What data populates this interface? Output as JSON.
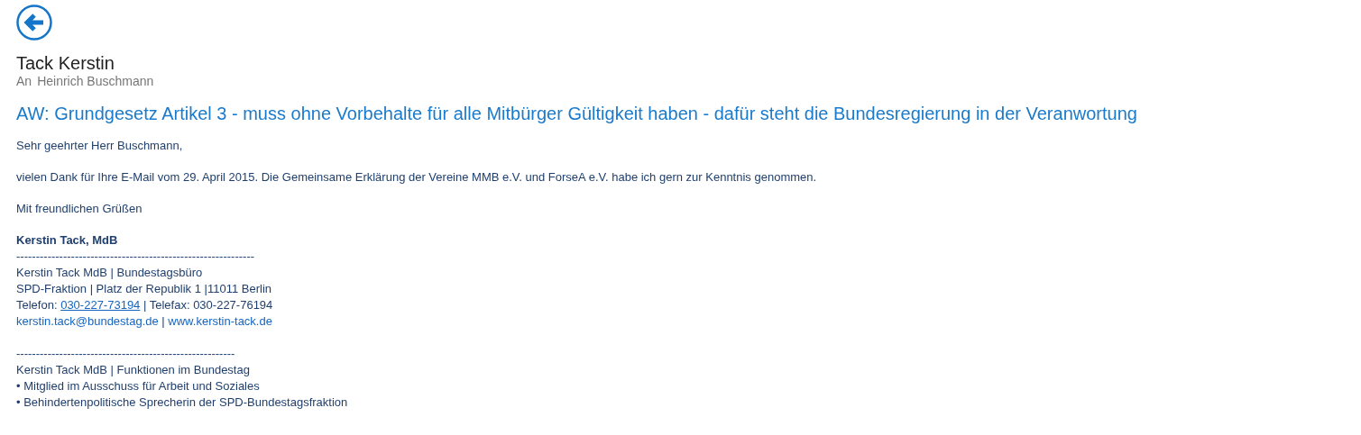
{
  "header": {
    "sender": "Tack Kerstin",
    "to_label": "An",
    "recipient": "Heinrich Buschmann"
  },
  "subject": "AW: Grundgesetz Artikel 3 - muss ohne Vorbehalte für alle Mitbürger Gültigkeit haben - dafür steht die Bundesregierung in der Veranwortung",
  "body": [
    {
      "kind": "paragraph",
      "text": "Sehr geehrter Herr Buschmann,"
    },
    {
      "kind": "paragraph",
      "text": "vielen Dank für Ihre E-Mail vom 29. April 2015. Die Gemeinsame Erklärung der Vereine MMB e.V. und ForseA e.V. habe ich gern zur Kenntnis genommen."
    },
    {
      "kind": "paragraph",
      "text": "Mit freundlichen Grüßen"
    },
    {
      "kind": "signature",
      "lines": [
        {
          "kind": "line",
          "segments": [
            {
              "kind": "bold",
              "text": "Kerstin Tack, MdB"
            }
          ]
        },
        {
          "kind": "line",
          "segments": [
            {
              "kind": "text",
              "text": "-------------------------------------------------------------"
            }
          ]
        },
        {
          "kind": "line",
          "segments": [
            {
              "kind": "text",
              "text": "Kerstin Tack MdB | Bundestagsbüro"
            }
          ]
        },
        {
          "kind": "line",
          "segments": [
            {
              "kind": "text",
              "text": "SPD-Fraktion | Platz der Republik 1 |11011 Berlin"
            }
          ]
        },
        {
          "kind": "line",
          "segments": [
            {
              "kind": "text",
              "text": "Telefon: "
            },
            {
              "kind": "underlined-link",
              "text": "030-227-73194"
            },
            {
              "kind": "text",
              "text": " | Telefax: 030-227-76194"
            }
          ]
        },
        {
          "kind": "line",
          "segments": [
            {
              "kind": "link",
              "text": "kerstin.tack@bundestag.de"
            },
            {
              "kind": "text",
              "text": " | "
            },
            {
              "kind": "link",
              "text": "www.kerstin-tack.de"
            }
          ]
        },
        {
          "kind": "gap"
        },
        {
          "kind": "line",
          "segments": [
            {
              "kind": "text",
              "text": "--------------------------------------------------------"
            }
          ]
        },
        {
          "kind": "line",
          "segments": [
            {
              "kind": "text",
              "text": "Kerstin Tack MdB | Funktionen im Bundestag"
            }
          ]
        },
        {
          "kind": "line",
          "segments": [
            {
              "kind": "text",
              "text": "• Mitglied im Ausschuss für Arbeit und Soziales"
            }
          ]
        },
        {
          "kind": "line",
          "segments": [
            {
              "kind": "text",
              "text": "• Behindertenpolitische Sprecherin der SPD-Bundestagsfraktion"
            }
          ]
        }
      ]
    }
  ]
}
